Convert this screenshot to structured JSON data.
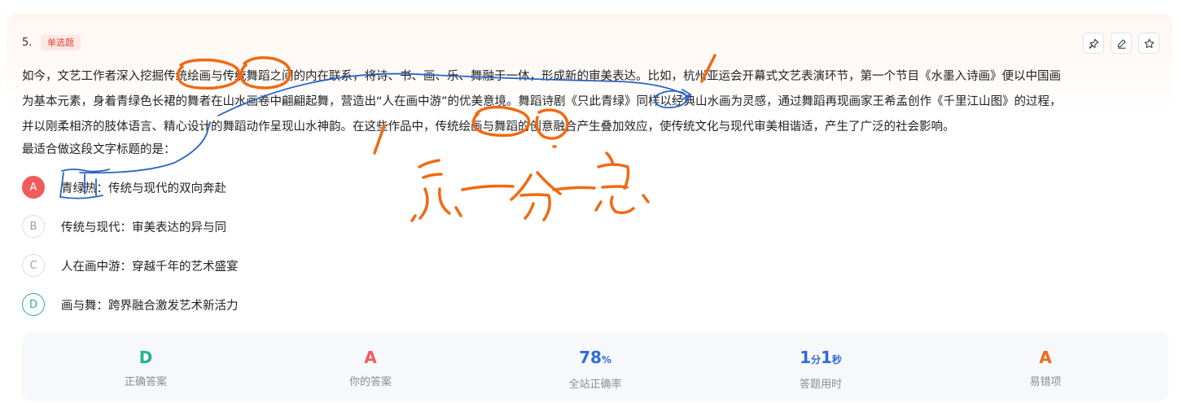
{
  "question": {
    "number": "5.",
    "type_badge": "单选题",
    "stem_lines": [
      "如今，文艺工作者深入挖掘传统绘画与传统舞蹈之间的内在联系，将诗、书、画、乐、舞融于一体，形成新的审美表达。比如，杭州亚运会开幕式文艺表演环节，第一个节目《水墨入诗画》便以中国画",
      "为基本元素，身着青绿色长裙的舞者在山水画卷中翩翩起舞，营造出“人在画中游”的优美意境。舞蹈诗剧《只此青绿》同样以经典山水画为灵感，通过舞蹈再现画家王希孟创作《千里江山图》的过程，",
      "并以刚柔相济的肢体语言、精心设计的舞蹈动作呈现山水神韵。在这些作品中，传统绘画与舞蹈的创意融合产生叠加效应，使传统文化与现代审美相谐适，产生了广泛的社会影响。"
    ],
    "prompt": "最适合做这段文字标题的是："
  },
  "toolbar": {
    "icons": [
      "pin-icon",
      "edit-icon",
      "star-icon"
    ]
  },
  "options": [
    {
      "letter": "A",
      "text": "青绿热：传统与现代的双向奔赴",
      "state": "wrong"
    },
    {
      "letter": "B",
      "text": "传统与现代：审美表达的异与同",
      "state": "normal"
    },
    {
      "letter": "C",
      "text": "人在画中游：穿越千年的艺术盛宴",
      "state": "normal"
    },
    {
      "letter": "D",
      "text": "画与舞：跨界融合激发艺术新活力",
      "state": "right"
    }
  ],
  "stats": {
    "correct_answer": {
      "value": "D",
      "label": "正确答案"
    },
    "your_answer": {
      "value": "A",
      "label": "你的答案"
    },
    "accuracy": {
      "value": "78",
      "unit": "%",
      "label": "全站正确率"
    },
    "time": {
      "min": "1",
      "min_unit": "分",
      "sec": "1",
      "sec_unit": "秒",
      "label": "答题用时"
    },
    "error_prone": {
      "value": "A",
      "label": "易错项"
    }
  },
  "handwriting": {
    "note": "总-分-总"
  },
  "colors": {
    "wrong": "#f25b5b",
    "right": "#22b58c",
    "blue_stat": "#2f6bd8",
    "orange_ink": "#f06a13",
    "blue_ink": "#2b63c6"
  }
}
